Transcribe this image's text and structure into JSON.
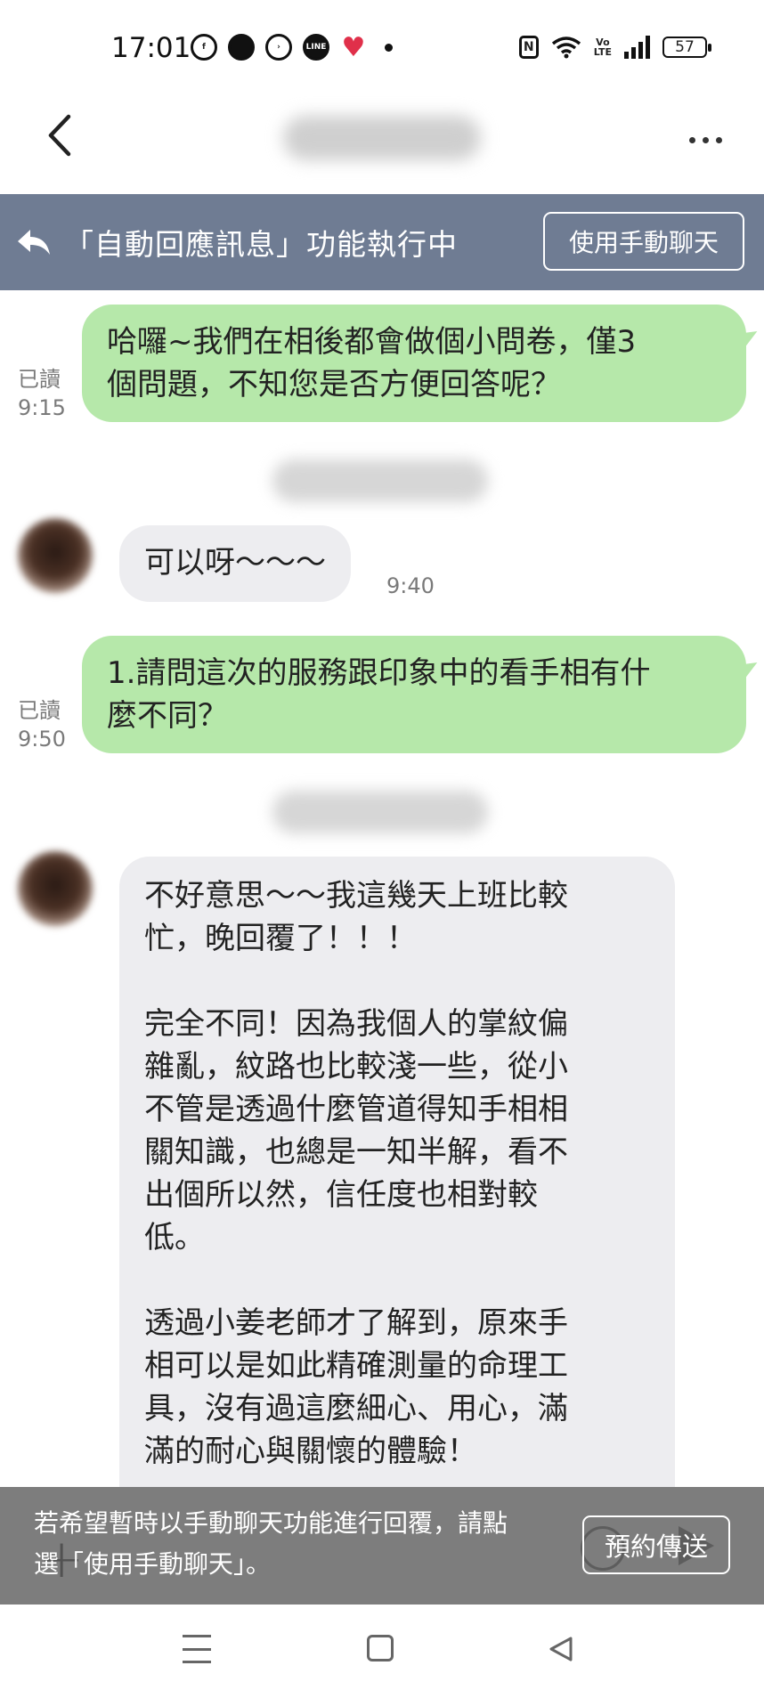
{
  "status_bar": {
    "time": "17:01",
    "notification_icons": [
      "messenger-icon",
      "chat-bubble-icon",
      "messenger-outline-icon",
      "line-icon",
      "heart-life-icon"
    ],
    "battery": "57"
  },
  "header": {
    "back_label": "‹",
    "more_label": "more options"
  },
  "banner": {
    "text": "「自動回應訊息」功能執行中",
    "manual_chat_button": "使用手動聊天"
  },
  "messages": [
    {
      "direction": "out",
      "text": "哈囉~我們在相後都會做個小問卷，僅3個問題，不知您是否方便回答呢？",
      "lines": [
        "哈囉~我們在相後都會做個小問卷，僅3",
        "個問題，不知您是否方便回答呢？"
      ],
      "read": "已讀",
      "time": "9:15"
    },
    {
      "direction": "in",
      "text": "可以呀～～～",
      "time": "9:40"
    },
    {
      "direction": "out",
      "lines": [
        "1.請問這次的服務跟印象中的看手相有什",
        "麼不同？"
      ],
      "read": "已讀",
      "time": "9:50"
    },
    {
      "direction": "in",
      "paragraphs": [
        [
          "不好意思～～我這幾天上班比較",
          "忙，晚回覆了！！！"
        ],
        [
          "完全不同！因為我個人的掌紋偏",
          "雜亂，紋路也比較淺一些，從小",
          "不管是透過什麼管道得知手相相",
          "關知識，也總是一知半解，看不",
          "出個所以然，信任度也相對較",
          "低。"
        ],
        [
          "透過小姜老師才了解到，原來手",
          "相可以是如此精確測量的命理工",
          "具，沒有過這麼細心、用心，滿",
          "滿的耐心與關懷的體驗！"
        ]
      ]
    }
  ],
  "hint": {
    "lines": [
      "若希望暫時以手動聊天功能進行回覆，請點",
      "選「使用手動聊天」。"
    ],
    "schedule_button": "預約傳送"
  },
  "colors": {
    "banner_bg": "#6f7c93",
    "outgoing_bubble": "#b6e8aa",
    "incoming_bubble": "#ededf0",
    "hint_bg": "#7d7d7d"
  }
}
